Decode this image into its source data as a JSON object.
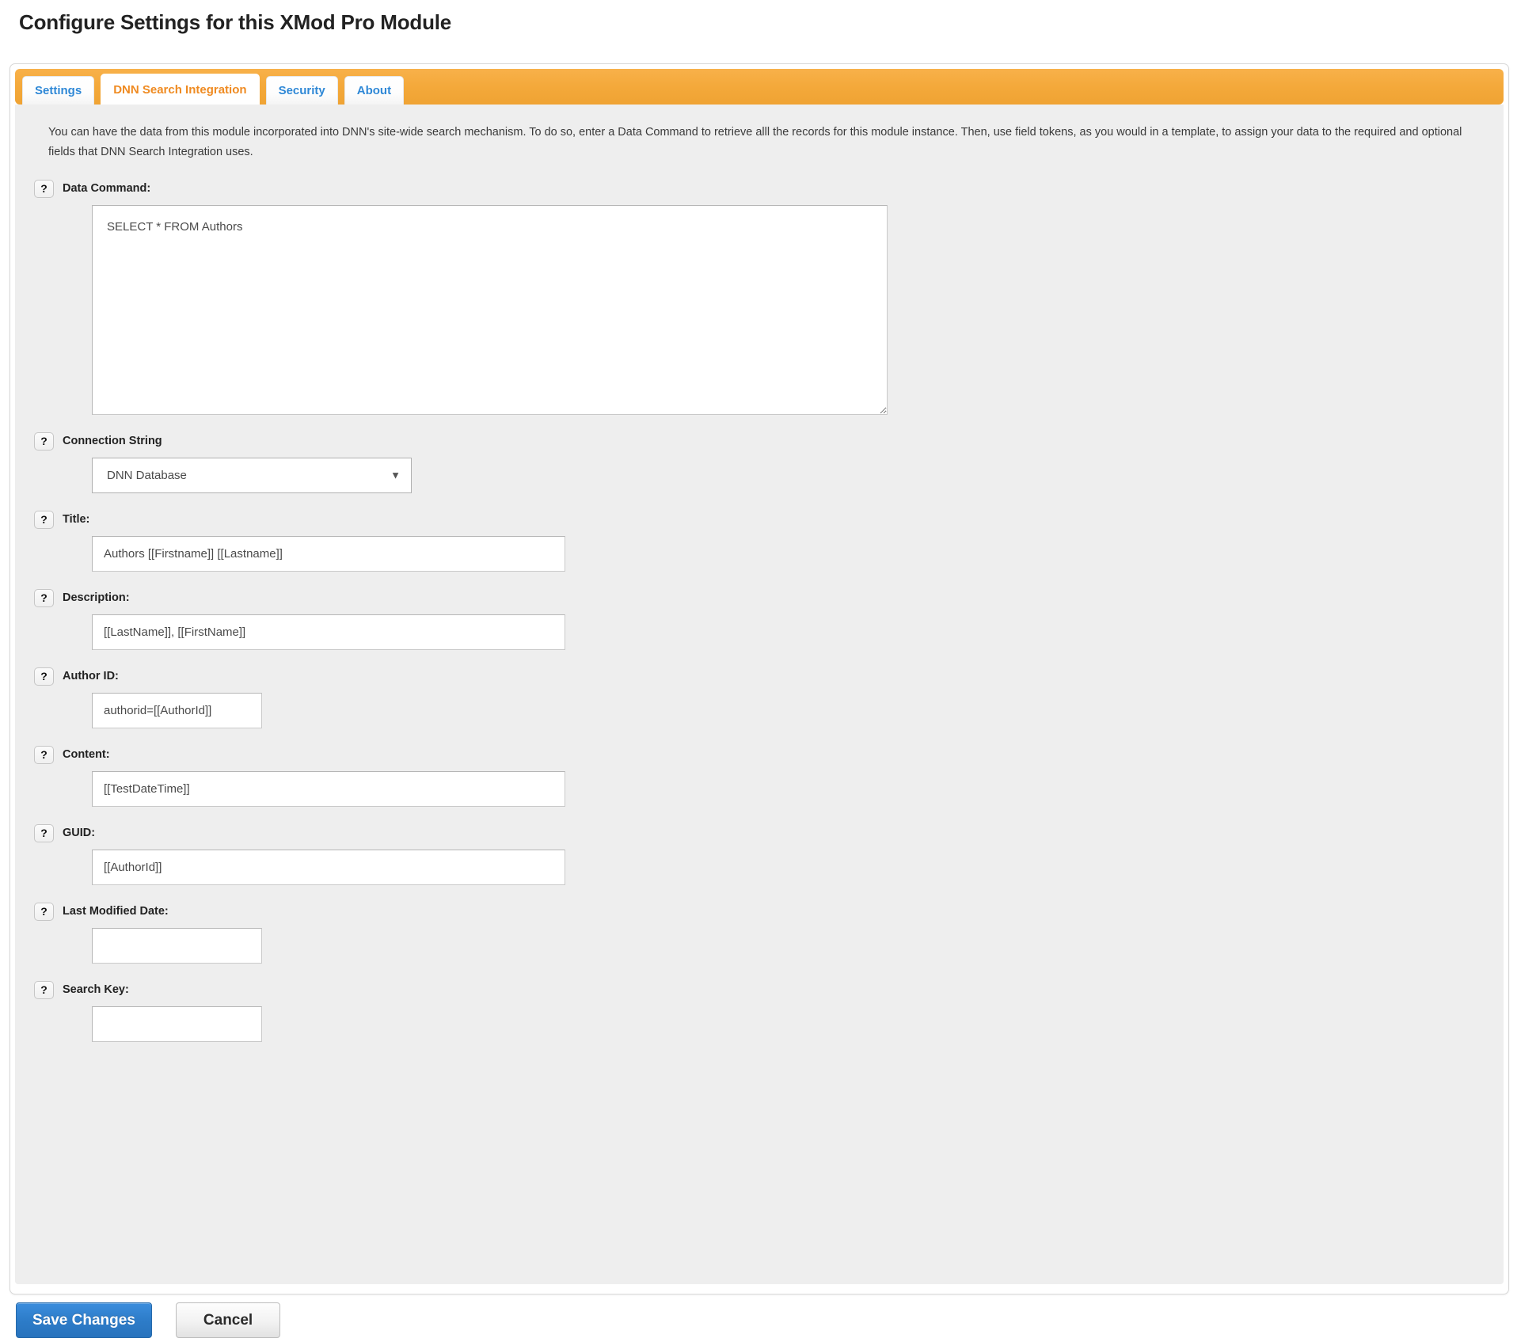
{
  "page": {
    "title": "Configure Settings for this XMod Pro Module"
  },
  "tabs": [
    {
      "label": "Settings",
      "active": false
    },
    {
      "label": "DNN Search Integration",
      "active": true
    },
    {
      "label": "Security",
      "active": false
    },
    {
      "label": "About",
      "active": false
    }
  ],
  "intro": "You can have the data from this module incorporated into DNN's site-wide search mechanism. To do so, enter a Data Command to retrieve alll the records for this module instance. Then, use field tokens, as you would in a template, to assign your data to the required and optional fields that DNN Search Integration uses.",
  "help_icon_label": "?",
  "fields": {
    "data_command": {
      "label": "Data Command:",
      "value": "SELECT * FROM Authors",
      "placeholder": ""
    },
    "connection_string": {
      "label": "Connection String",
      "selected": "DNN Database",
      "options": [
        "DNN Database"
      ],
      "arrow": "▼"
    },
    "title": {
      "label": "Title:",
      "value": "Authors [[Firstname]] [[Lastname]]",
      "placeholder": ""
    },
    "description": {
      "label": "Description:",
      "value": "[[LastName]], [[FirstName]]",
      "placeholder": ""
    },
    "author_id": {
      "label": "Author ID:",
      "value": "authorid=[[AuthorId]]",
      "placeholder": ""
    },
    "content": {
      "label": "Content:",
      "value": "[[TestDateTime]]",
      "placeholder": ""
    },
    "guid": {
      "label": "GUID:",
      "value": "[[AuthorId]]",
      "placeholder": ""
    },
    "last_modified_date": {
      "label": "Last Modified Date:",
      "value": "",
      "placeholder": ""
    },
    "search_key": {
      "label": "Search Key:",
      "value": "",
      "placeholder": ""
    }
  },
  "buttons": {
    "save": "Save Changes",
    "cancel": "Cancel"
  },
  "colors": {
    "tab_strip_orange": "#f4a93b",
    "active_tab_text": "#ef8b22",
    "tab_text": "#2f88d6",
    "primary_button": "#2d7cc8",
    "body_background": "#eeeeee"
  }
}
